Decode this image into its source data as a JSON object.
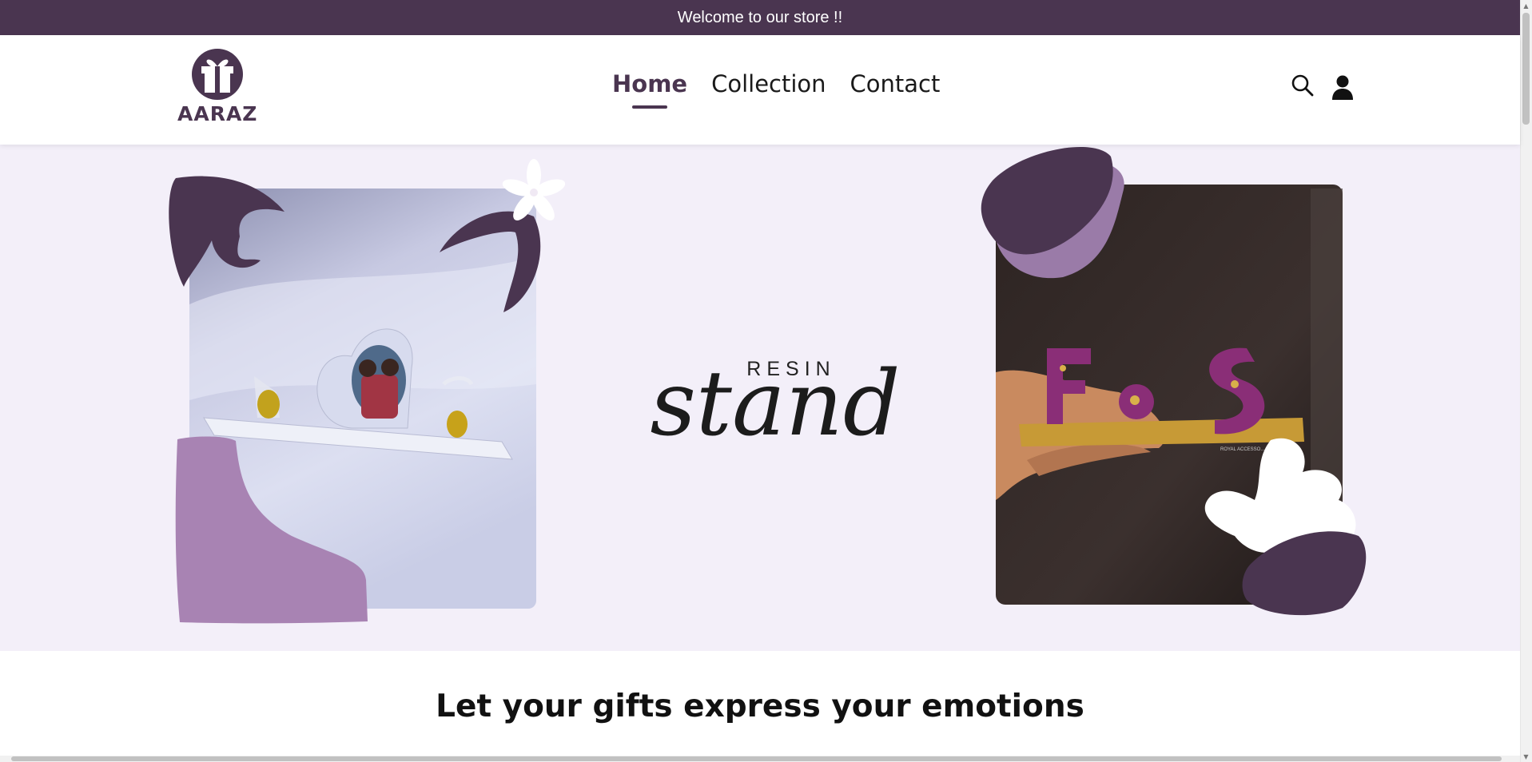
{
  "announcement": {
    "text": "Welcome to our store !!"
  },
  "header": {
    "logo_text": "AARAZ",
    "nav": [
      {
        "label": "Home",
        "active": true
      },
      {
        "label": "Collection",
        "active": false
      },
      {
        "label": "Contact",
        "active": false
      }
    ],
    "icons": [
      "search-icon",
      "user-icon"
    ]
  },
  "hero": {
    "small_text": "RESIN",
    "script_text": "stand",
    "photo_tag": "ROYAL ACCESSO..."
  },
  "tagline": "Let your gifts express your emotions",
  "colors": {
    "brand": "#4a3550",
    "accent_light": "#a883b3",
    "hero_bg": "#f3eff9"
  }
}
